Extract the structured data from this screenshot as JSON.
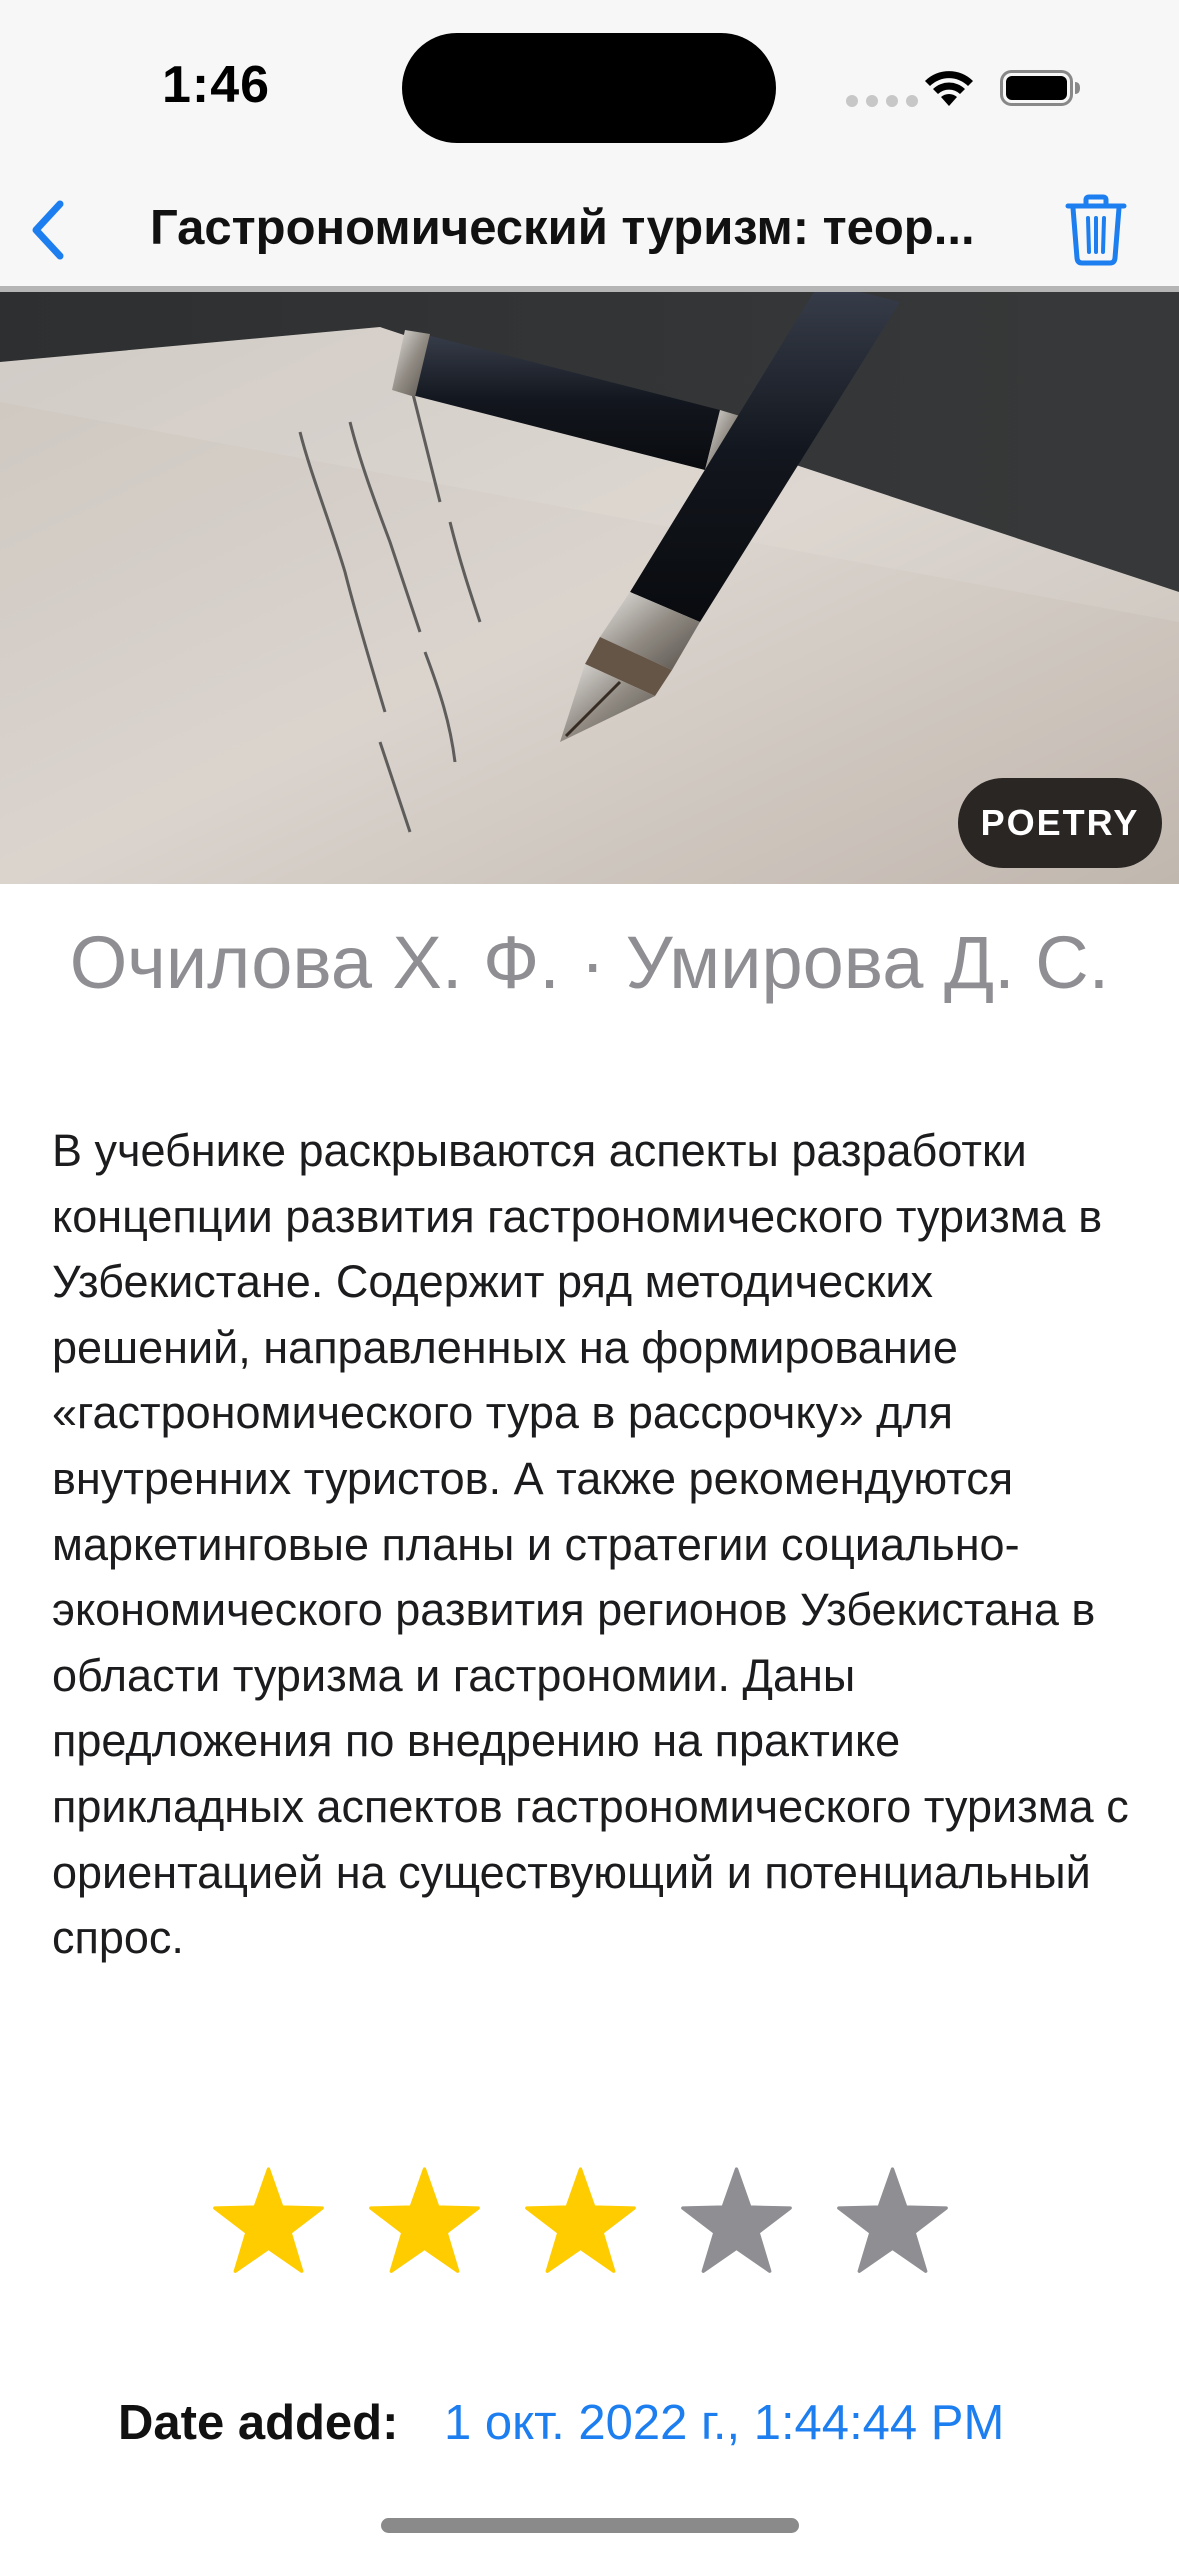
{
  "status_bar": {
    "time": "1:46"
  },
  "nav": {
    "title": "Гастрономический туризм: теор...",
    "back_icon": "chevron-left-icon",
    "delete_icon": "trash-icon",
    "accent_color": "#1d7ef0"
  },
  "book": {
    "category": "POETRY",
    "authors": "Очилова Х. Ф. · Умирова Д. С.",
    "description": "В учебнике раскрываются аспекты разработки концепции развития гастрономического туризма в Узбекистане. Содержит ряд методических решений, направленных на формирование «гастрономического тура в рассрочку» для внутренних туристов. А также рекомендуются маркетинговые планы и стратегии социально-экономического развития регионов Узбекистана в области туризма и гастрономии. Даны предложения по внедрению на практике прикладных аспектов гастрономического туризма с ориентацией на существующий и потенциальный спрос.",
    "rating": 3,
    "rating_max": 5,
    "rating_filled_color": "#ffcc00",
    "rating_empty_color": "#8e8e93"
  },
  "date": {
    "label": "Date added:",
    "value": "1 окт. 2022 г., 1:44:44 PM"
  }
}
